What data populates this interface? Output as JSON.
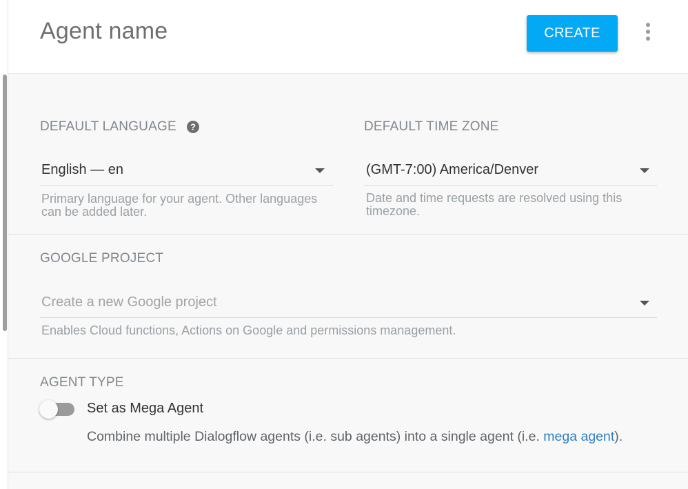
{
  "header": {
    "agent_name_placeholder": "Agent name",
    "create_label": "CREATE"
  },
  "language": {
    "label": "DEFAULT LANGUAGE",
    "value": "English — en",
    "hint_line1": "Primary language for your agent. Other languages",
    "hint_line2": "can be added later."
  },
  "timezone": {
    "label": "DEFAULT TIME ZONE",
    "value": "(GMT-7:00) America/Denver",
    "hint_line1": "Date and time requests are resolved using this",
    "hint_line2": "timezone."
  },
  "google_project": {
    "label": "GOOGLE PROJECT",
    "placeholder": "Create a new Google project",
    "hint": "Enables Cloud functions, Actions on Google and permissions management."
  },
  "agent_type": {
    "label": "AGENT TYPE",
    "toggle_label": "Set as Mega Agent",
    "toggle_on": false,
    "desc_before": "Combine multiple Dialogflow agents (i.e. sub agents) into a single agent (i.e. ",
    "desc_link": "mega agent",
    "desc_after": ")."
  },
  "colors": {
    "accent": "#03a9f4",
    "link": "#2f7fc0"
  },
  "icons": {
    "help": "help-circle-icon",
    "more": "more-vert-icon",
    "dropdown": "caret-down-icon"
  }
}
